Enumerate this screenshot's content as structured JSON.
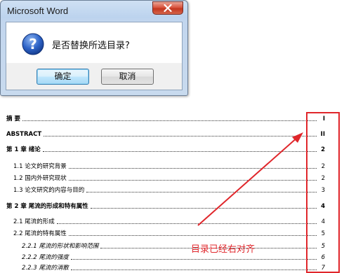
{
  "dialog": {
    "title": "Microsoft Word",
    "message": "是否替换所选目录?",
    "ok_label": "确定",
    "cancel_label": "取消",
    "icon": "question-icon",
    "close_icon": "close-icon"
  },
  "toc": {
    "entries": [
      {
        "label": "摘    要",
        "page": "I"
      },
      {
        "label": "ABSTRACT",
        "page": "II"
      },
      {
        "label": "第 1 章    绪论",
        "page": "2"
      },
      {
        "label": "1.1   论文的研究背景",
        "page": "2"
      },
      {
        "label": "1.2   国内外研究现状",
        "page": "2"
      },
      {
        "label": "1.3   论文研究的内容与目的",
        "page": "3"
      },
      {
        "label": "第 2 章    尾流的形成和特有属性",
        "page": "4"
      },
      {
        "label": "2.1   尾流的形成",
        "page": "4"
      },
      {
        "label": "2.2   尾流的特有属性",
        "page": "5"
      },
      {
        "label": "2.2.1   尾流的形状和影响范围",
        "page": "5"
      },
      {
        "label": "2.2.2   尾流的强度",
        "page": "6"
      },
      {
        "label": "2.2.3   尾流的消散",
        "page": "7"
      }
    ]
  },
  "annotation": {
    "text": "目录已经右对齐",
    "color": "#e0262b"
  }
}
